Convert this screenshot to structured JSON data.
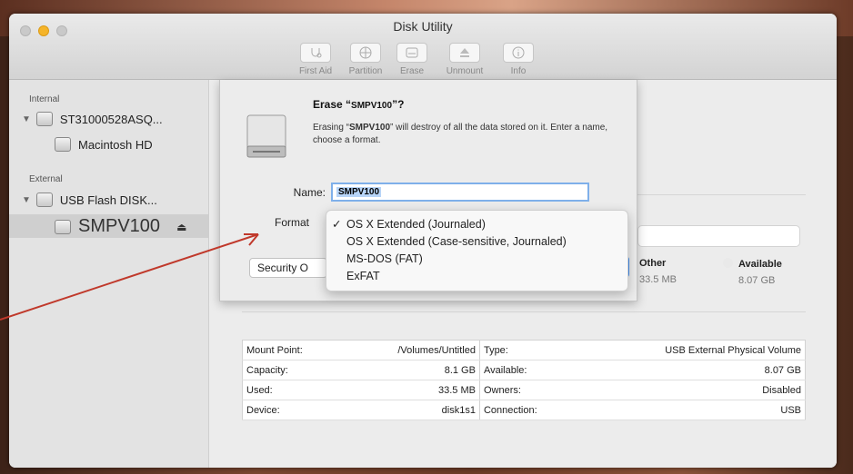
{
  "window": {
    "title": "Disk Utility"
  },
  "toolbar": [
    {
      "label": "First Aid",
      "icon": "stethoscope-icon"
    },
    {
      "label": "Partition",
      "icon": "partition-icon"
    },
    {
      "label": "Erase",
      "icon": "erase-icon"
    },
    {
      "label": "Unmount",
      "icon": "eject-icon"
    },
    {
      "label": "Info",
      "icon": "info-icon"
    }
  ],
  "sidebar": {
    "internal_label": "Internal",
    "external_label": "External",
    "items": [
      {
        "label": "ST31000528ASQ...",
        "icon": "disk-icon",
        "expanded": true
      },
      {
        "label": "Macintosh HD",
        "icon": "volume-icon"
      },
      {
        "label": "USB Flash DISK...",
        "icon": "disk-icon",
        "expanded": true
      },
      {
        "label": "SMPV100",
        "icon": "volume-icon",
        "selected": true,
        "eject": "⏏"
      }
    ]
  },
  "erase_sheet": {
    "title_prefix": "Erase “",
    "title_name": "SMPV100",
    "title_suffix": "”?",
    "message_prefix": "Erasing “",
    "message_name": "SMPV100",
    "message_suffix": "” will destroy of all the data stored on it. Enter a name, choose a format.",
    "name_label": "Name:",
    "name_value": "SMPV100",
    "format_label": "Format",
    "security_button": "Security O",
    "format_options": [
      {
        "label": "OS X Extended (Journaled)",
        "checked": true
      },
      {
        "label": "OS X Extended (Case-sensitive, Journaled)",
        "checked": false
      },
      {
        "label": "MS-DOS (FAT)",
        "checked": false
      },
      {
        "label": "ExFAT",
        "checked": false
      }
    ],
    "check_mark": "✓"
  },
  "usage": {
    "other_label": "Other",
    "other_value": "33.5 MB",
    "available_label": "Available",
    "available_value": "8.07 GB"
  },
  "info_table": [
    {
      "k1": "Mount Point:",
      "v1": "/Volumes/Untitled",
      "k2": "Type:",
      "v2": "USB External Physical Volume"
    },
    {
      "k1": "Capacity:",
      "v1": "8.1 GB",
      "k2": "Available:",
      "v2": "8.07 GB"
    },
    {
      "k1": "Used:",
      "v1": "33.5 MB",
      "k2": "Owners:",
      "v2": "Disabled"
    },
    {
      "k1": "Device:",
      "v1": "disk1s1",
      "k2": "Connection:",
      "v2": "USB"
    }
  ],
  "colors": {
    "accent": "#3f8ef0",
    "arrow": "#c0392b"
  }
}
